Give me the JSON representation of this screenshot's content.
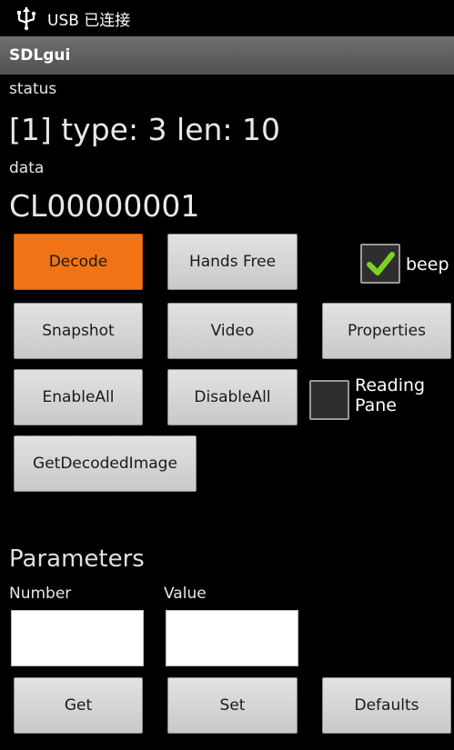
{
  "statusbar": {
    "text": "USB 已连接",
    "icon": "usb-icon"
  },
  "app": {
    "title": "SDLgui"
  },
  "status": {
    "label": "status",
    "value": "[1] type: 3 len: 10"
  },
  "data": {
    "label": "data",
    "value": "CL00000001"
  },
  "buttons": {
    "decode": "Decode",
    "hands_free": "Hands Free",
    "snapshot": "Snapshot",
    "video": "Video",
    "properties": "Properties",
    "enable_all": "EnableAll",
    "disable_all": "DisableAll",
    "get_decoded_image": "GetDecodedImage",
    "get": "Get",
    "set": "Set",
    "defaults": "Defaults"
  },
  "checkboxes": {
    "beep": {
      "label": "beep",
      "checked": true
    },
    "reading_pane": {
      "label_line1": "Reading",
      "label_line2": "Pane",
      "checked": false
    }
  },
  "parameters": {
    "heading": "Parameters",
    "number_label": "Number",
    "value_label": "Value",
    "number_value": "",
    "value_value": ""
  },
  "colors": {
    "accent": "#F07415",
    "check": "#7ED321"
  }
}
